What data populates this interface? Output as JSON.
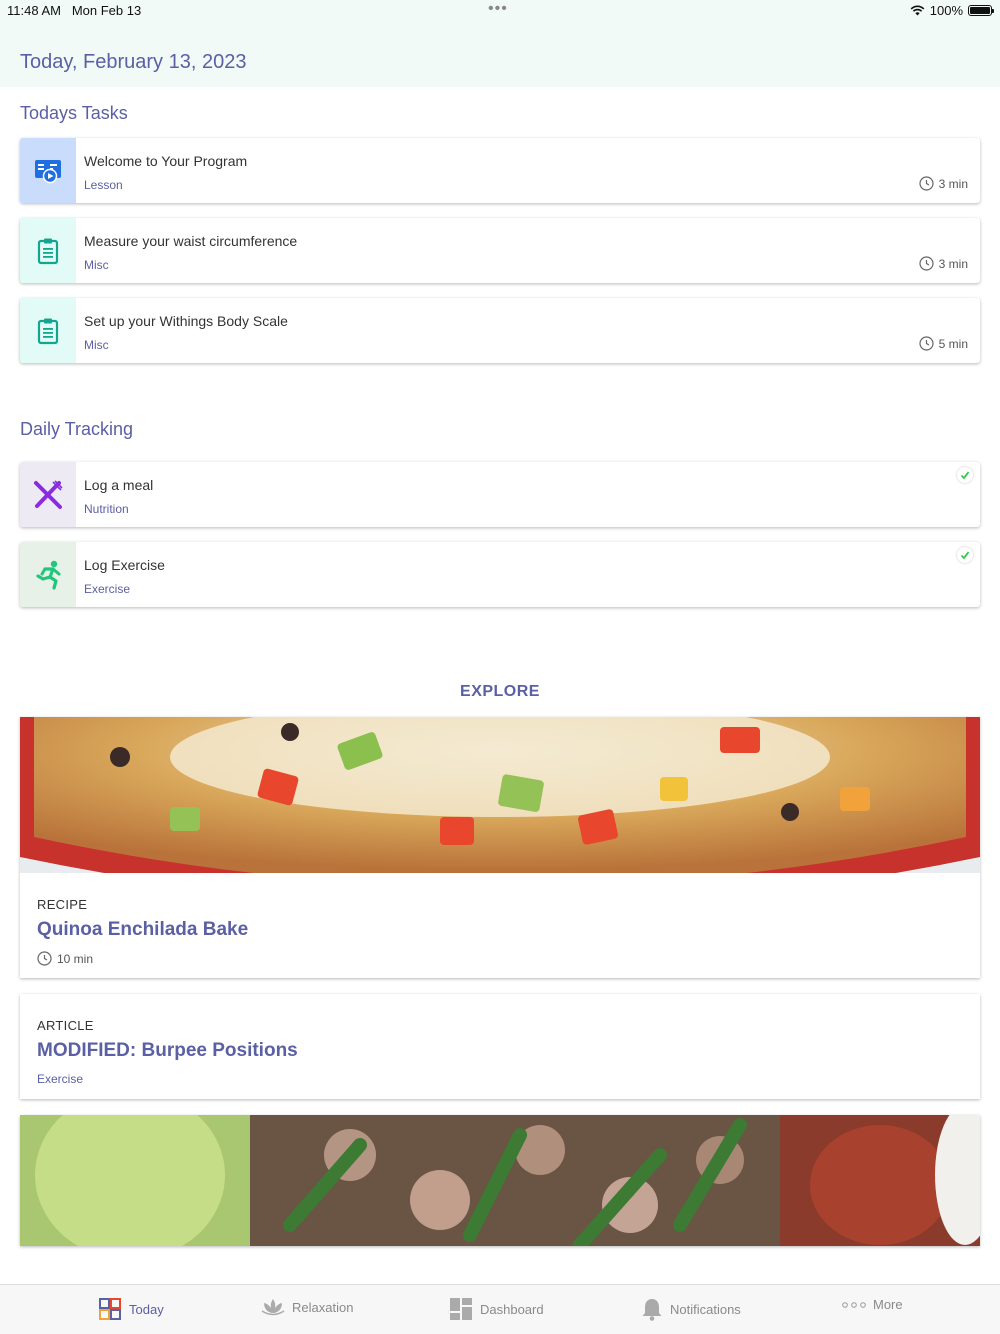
{
  "status": {
    "time": "11:48 AM",
    "date": "Mon Feb 13",
    "battery": "100%"
  },
  "header": {
    "date": "Today, February 13, 2023"
  },
  "tasks": {
    "title": "Todays Tasks",
    "items": [
      {
        "title": "Welcome to Your Program",
        "category": "Lesson",
        "duration": "3 min",
        "icon": "lesson-video-icon"
      },
      {
        "title": "Measure your waist circumference",
        "category": "Misc",
        "duration": "3 min",
        "icon": "clipboard-icon"
      },
      {
        "title": "Set up your Withings Body Scale",
        "category": "Misc",
        "duration": "5 min",
        "icon": "clipboard-icon"
      }
    ]
  },
  "tracking": {
    "title": "Daily Tracking",
    "items": [
      {
        "title": "Log a meal",
        "category": "Nutrition",
        "icon": "fork-knife-icon",
        "done": true
      },
      {
        "title": "Log Exercise",
        "category": "Exercise",
        "icon": "running-icon",
        "done": true
      }
    ]
  },
  "explore": {
    "title": "EXPLORE",
    "cards": [
      {
        "kind": "RECIPE",
        "title": "Quinoa Enchilada Bake",
        "duration": "10 min"
      },
      {
        "kind": "ARTICLE",
        "title": "MODIFIED: Burpee Positions",
        "category": "Exercise"
      }
    ]
  },
  "tabs": [
    {
      "label": "Today",
      "icon": "today-logo-icon",
      "active": true
    },
    {
      "label": "Relaxation",
      "icon": "lotus-icon"
    },
    {
      "label": "Dashboard",
      "icon": "dashboard-icon"
    },
    {
      "label": "Notifications",
      "icon": "bell-icon"
    },
    {
      "label": "More",
      "icon": "more-dots-icon"
    }
  ],
  "colors": {
    "accent": "#5b5fa3",
    "header_bg": "#f1faf7",
    "lesson_bg": "#c9dcfb",
    "misc_bg": "#e3fbf7",
    "nutrition_bg": "#eeeaf3",
    "exercise_bg": "#e8f1e7",
    "check": "#2ecc40"
  }
}
